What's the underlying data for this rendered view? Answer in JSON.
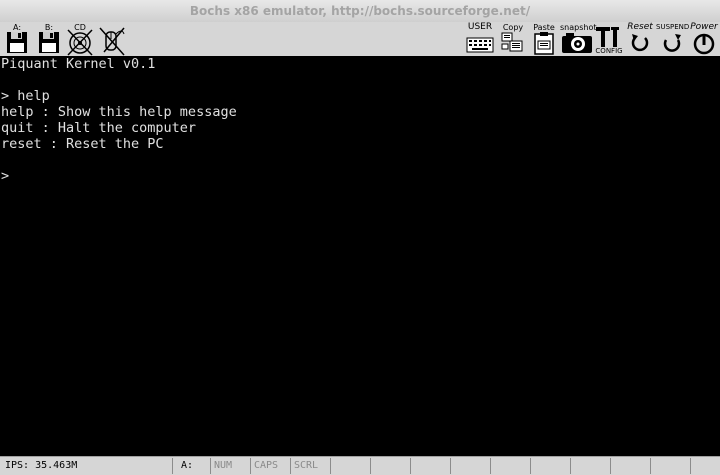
{
  "window": {
    "title": "Bochs x86 emulator, http://bochs.sourceforge.net/"
  },
  "toolbar": {
    "floppy_a_label": "A:",
    "floppy_b_label": "B:",
    "cdrom_label": "CD",
    "user_label": "USER",
    "copy_label": "Copy",
    "paste_label": "Paste",
    "snapshot_label": "snapshot",
    "config_label": "CONFIG",
    "reset_label": "Reset",
    "suspend_label": "SUSPEND",
    "power_label": "Power"
  },
  "console": {
    "lines": [
      "Piquant Kernel v0.1",
      "",
      "> help",
      "help : Show this help message",
      "quit : Halt the computer",
      "reset : Reset the PC",
      "",
      ">"
    ]
  },
  "statusbar": {
    "ips": "IPS: 35.463M",
    "drive": "A:",
    "num": "NUM",
    "caps": "CAPS",
    "scrl": "SCRL"
  }
}
